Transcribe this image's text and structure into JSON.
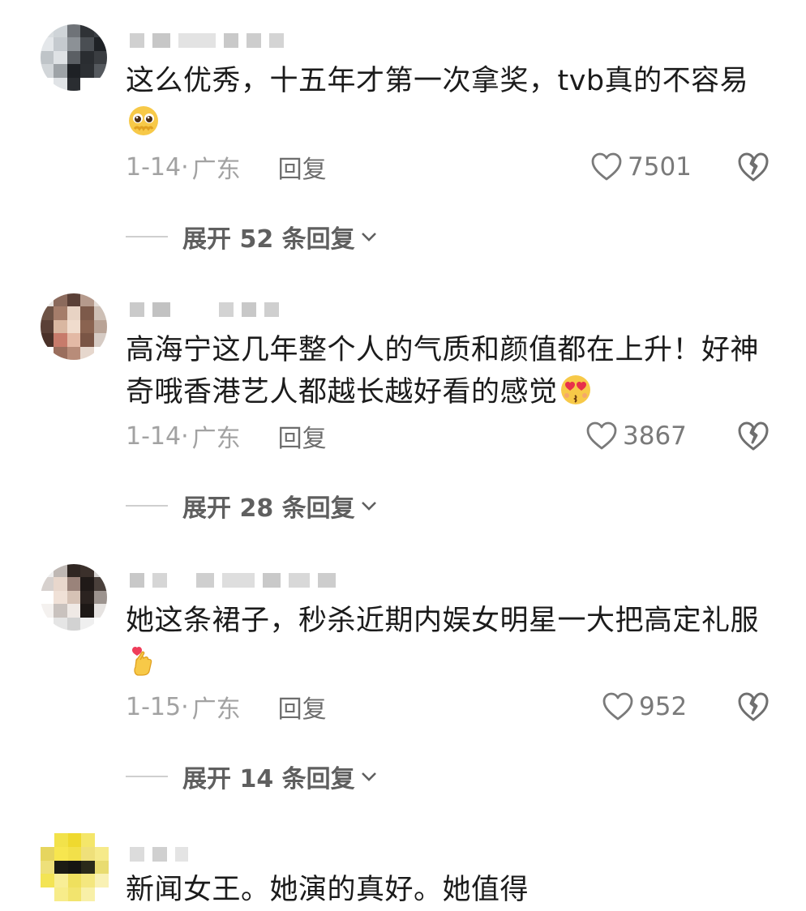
{
  "comments": [
    {
      "text": "这么优秀，十五年才第一次拿奖，tvb真的不容易",
      "emoji": "pleading-face-emoji",
      "date": "1-14",
      "location": "广东",
      "reply_label": "回复",
      "likes": "7501",
      "expand_label": "展开 52 条回复"
    },
    {
      "text": "高海宁这几年整个人的气质和颜值都在上升！好神奇哦香港艺人都越长越好看的感觉",
      "emoji": "heart-eyes-emoji",
      "date": "1-14",
      "location": "广东",
      "reply_label": "回复",
      "likes": "3867",
      "expand_label": "展开 28 条回复"
    },
    {
      "text": "她这条裙子，秒杀近期内娱女明星一大把高定礼服",
      "emoji": "finger-heart-emoji",
      "date": "1-15",
      "location": "广东",
      "reply_label": "回复",
      "likes": "952",
      "expand_label": "展开 14 条回复"
    },
    {
      "text": "新闻女王。她演的真好。她值得"
    }
  ],
  "colors": {
    "text": "#1b1b1b",
    "meta": "#a2a2a2",
    "reply": "#6d6d6d",
    "expand": "#5f5f5f"
  }
}
